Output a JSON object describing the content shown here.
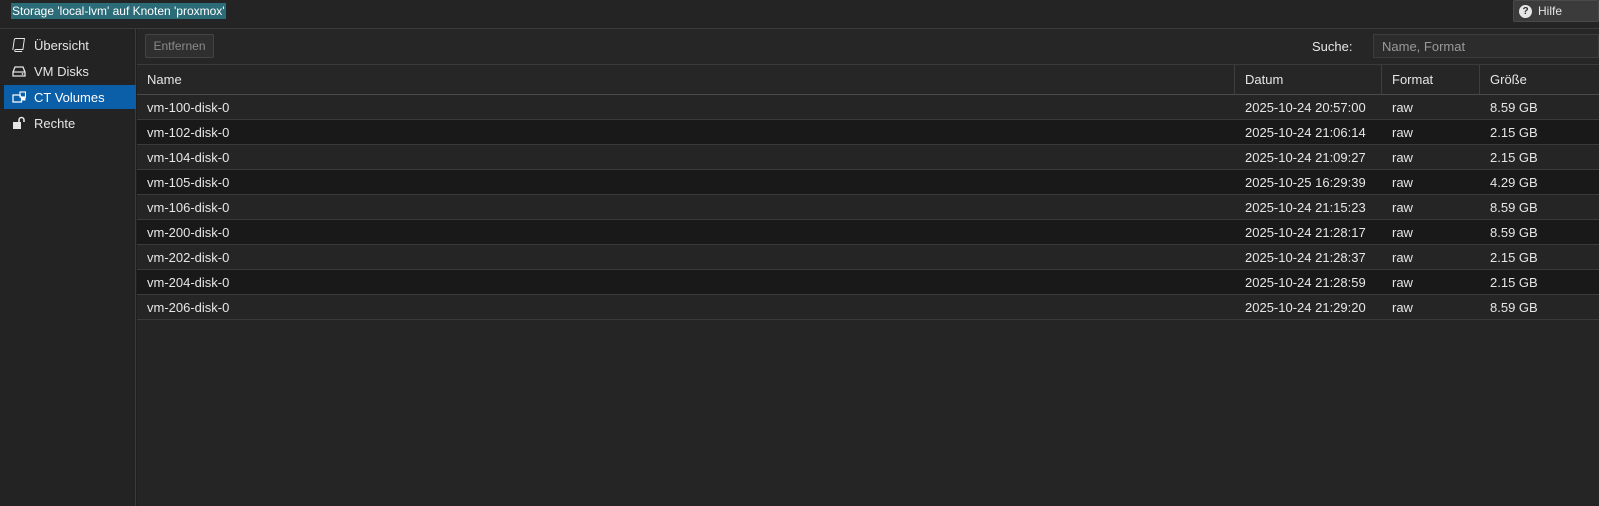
{
  "window": {
    "title": "Storage 'local-lvm' auf Knoten 'proxmox'",
    "help_label": "Hilfe"
  },
  "sidebar": {
    "items": [
      {
        "label": "Übersicht",
        "icon": "book-icon",
        "active": false
      },
      {
        "label": "VM Disks",
        "icon": "hdd-icon",
        "active": false
      },
      {
        "label": "CT Volumes",
        "icon": "ct-volumes-icon",
        "active": true
      },
      {
        "label": "Rechte",
        "icon": "unlock-icon",
        "active": false
      }
    ]
  },
  "toolbar": {
    "remove_label": "Entfernen",
    "search_label": "Suche:",
    "search_placeholder": "Name, Format",
    "search_value": ""
  },
  "table": {
    "columns": [
      "Name",
      "Datum",
      "Format",
      "Größe"
    ],
    "rows": [
      [
        "vm-100-disk-0",
        "2025-10-24 20:57:00",
        "raw",
        "8.59 GB"
      ],
      [
        "vm-102-disk-0",
        "2025-10-24 21:06:14",
        "raw",
        "2.15 GB"
      ],
      [
        "vm-104-disk-0",
        "2025-10-24 21:09:27",
        "raw",
        "2.15 GB"
      ],
      [
        "vm-105-disk-0",
        "2025-10-25 16:29:39",
        "raw",
        "4.29 GB"
      ],
      [
        "vm-106-disk-0",
        "2025-10-24 21:15:23",
        "raw",
        "8.59 GB"
      ],
      [
        "vm-200-disk-0",
        "2025-10-24 21:28:17",
        "raw",
        "8.59 GB"
      ],
      [
        "vm-202-disk-0",
        "2025-10-24 21:28:37",
        "raw",
        "2.15 GB"
      ],
      [
        "vm-204-disk-0",
        "2025-10-24 21:28:59",
        "raw",
        "2.15 GB"
      ],
      [
        "vm-206-disk-0",
        "2025-10-24 21:29:20",
        "raw",
        "8.59 GB"
      ]
    ]
  },
  "colors": {
    "accent": "#0b5ea8",
    "title_highlight": "#2b6c78"
  }
}
